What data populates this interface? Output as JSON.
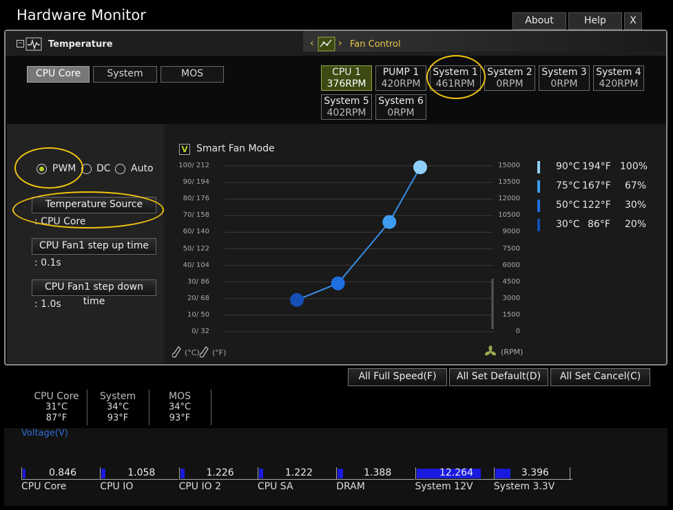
{
  "app": {
    "title": "Hardware Monitor"
  },
  "top_buttons": {
    "about": "About",
    "help": "Help",
    "close": "X"
  },
  "sections": {
    "temperature": "Temperature",
    "fan_control": "Fan Control"
  },
  "temp_tabs": [
    {
      "label": "CPU Core",
      "selected": true
    },
    {
      "label": "System",
      "selected": false
    },
    {
      "label": "MOS",
      "selected": false
    }
  ],
  "fans": [
    {
      "name": "CPU 1",
      "rpm": "376RPM",
      "selected": true
    },
    {
      "name": "PUMP 1",
      "rpm": "420RPM",
      "selected": false
    },
    {
      "name": "System 1",
      "rpm": "461RPM",
      "selected": false
    },
    {
      "name": "System 2",
      "rpm": "0RPM",
      "selected": false
    },
    {
      "name": "System 3",
      "rpm": "0RPM",
      "selected": false
    },
    {
      "name": "System 4",
      "rpm": "420RPM",
      "selected": false
    },
    {
      "name": "System 5",
      "rpm": "402RPM",
      "selected": false
    },
    {
      "name": "System 6",
      "rpm": "0RPM",
      "selected": false
    }
  ],
  "mode": {
    "pwm": "PWM",
    "dc": "DC",
    "auto": "Auto",
    "selected": "PWM"
  },
  "settings": {
    "temp_source_label": "Temperature Source",
    "temp_source_value": ": CPU Core",
    "step_up_label": "CPU Fan1 step up time",
    "step_up_value": ": 0.1s",
    "step_down_label": "CPU Fan1 step down time",
    "step_down_value": ": 1.0s"
  },
  "smart_fan": {
    "label": "Smart Fan Mode",
    "checked": true,
    "check_glyph": "V"
  },
  "chart_data": {
    "type": "line",
    "left_axis_ticks": [
      "100/ 212",
      "90/ 194",
      "80/ 176",
      "70/ 158",
      "60/ 140",
      "50/ 122",
      "40/ 104",
      "30/  86",
      "20/  68",
      "10/  50",
      "0/  32"
    ],
    "right_axis_ticks": [
      "15000",
      "13500",
      "12000",
      "10500",
      "9000",
      "7500",
      "6000",
      "4500",
      "3000",
      "1500",
      "0"
    ],
    "ylim": [
      0,
      100
    ],
    "points": [
      {
        "x": 30,
        "y": 20
      },
      {
        "x": 50,
        "y": 30
      },
      {
        "x": 75,
        "y": 67
      },
      {
        "x": 90,
        "y": 100
      }
    ],
    "point_colors": [
      "#1450b4",
      "#1e6fe0",
      "#3d9cf0",
      "#8fd0fa"
    ],
    "left_unit_c": "(°C)",
    "left_unit_f": "(°F)",
    "right_unit": "(RPM)",
    "grid": true
  },
  "legend": [
    {
      "c": "90°C",
      "f": "194°F",
      "pct": "100%",
      "color": "#8fd0fa"
    },
    {
      "c": "75°C",
      "f": "167°F",
      "pct": "67%",
      "color": "#3d9cf0"
    },
    {
      "c": "50°C",
      "f": "122°F",
      "pct": "30%",
      "color": "#1e6fe0"
    },
    {
      "c": "30°C",
      "f": "86°F",
      "pct": "20%",
      "color": "#1450b4"
    }
  ],
  "actions": {
    "full_speed": "All Full Speed(F)",
    "set_default": "All Set Default(D)",
    "set_cancel": "All Set Cancel(C)"
  },
  "readings": [
    {
      "name": "CPU Core",
      "c": "31°C",
      "f": "87°F"
    },
    {
      "name": "System",
      "c": "34°C",
      "f": "93°F"
    },
    {
      "name": "MOS",
      "c": "34°C",
      "f": "93°F"
    }
  ],
  "voltage": {
    "title": "Voltage(V)",
    "items": [
      {
        "name": "CPU Core",
        "value": "0.846",
        "level": 0.04
      },
      {
        "name": "CPU IO",
        "value": "1.058",
        "level": 0.05
      },
      {
        "name": "CPU IO 2",
        "value": "1.226",
        "level": 0.06
      },
      {
        "name": "CPU SA",
        "value": "1.222",
        "level": 0.06
      },
      {
        "name": "DRAM",
        "value": "1.388",
        "level": 0.07
      },
      {
        "name": "System 12V",
        "value": "12.264",
        "level": 0.85
      },
      {
        "name": "System 3.3V",
        "value": "3.396",
        "level": 0.2
      }
    ]
  }
}
